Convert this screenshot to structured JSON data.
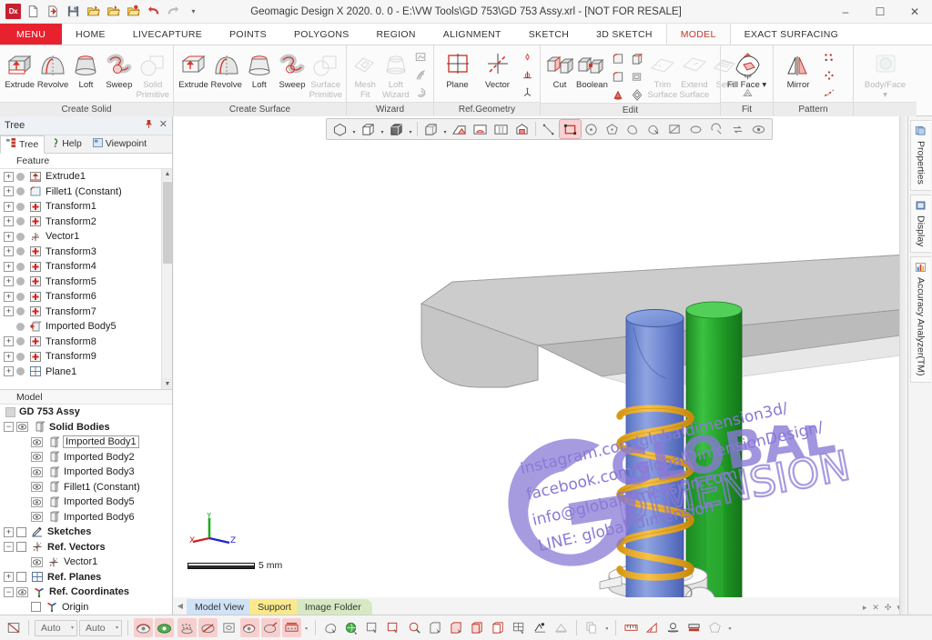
{
  "window": {
    "title": "Geomagic Design X 2020. 0. 0 - E:\\VW Tools\\GD 753\\GD 753 Assy.xrl - [NOT FOR RESALE]",
    "app_badge": "Dx",
    "minimize": "–",
    "maximize": "☐",
    "close": "✕"
  },
  "quick_access": [
    {
      "name": "app-logo-icon",
      "label": "Dx"
    },
    {
      "name": "new-document-icon",
      "label": ""
    },
    {
      "name": "import-icon",
      "label": ""
    },
    {
      "name": "save-icon",
      "label": ""
    },
    {
      "name": "open-folder-icon",
      "label": ""
    },
    {
      "name": "open-folder-2-icon",
      "label": ""
    },
    {
      "name": "open-folder-3-icon",
      "label": ""
    },
    {
      "name": "undo-icon",
      "label": ""
    },
    {
      "name": "redo-icon",
      "label": ""
    },
    {
      "name": "customize-caret-icon",
      "label": "▾"
    }
  ],
  "ribbon_tabs": [
    {
      "label": "MENU",
      "kind": "menu"
    },
    {
      "label": "HOME",
      "kind": "normal"
    },
    {
      "label": "LIVECAPTURE",
      "kind": "normal"
    },
    {
      "label": "POINTS",
      "kind": "normal"
    },
    {
      "label": "POLYGONS",
      "kind": "normal"
    },
    {
      "label": "REGION",
      "kind": "normal"
    },
    {
      "label": "ALIGNMENT",
      "kind": "normal"
    },
    {
      "label": "SKETCH",
      "kind": "normal"
    },
    {
      "label": "3D SKETCH",
      "kind": "normal"
    },
    {
      "label": "MODEL",
      "kind": "active"
    },
    {
      "label": "EXACT SURFACING",
      "kind": "normal"
    }
  ],
  "ribbon_groups": [
    {
      "label": "Create Solid",
      "items": [
        {
          "label": "Extrude",
          "icon": "extrude-solid-icon",
          "disabled": false
        },
        {
          "label": "Revolve",
          "icon": "revolve-solid-icon",
          "disabled": false
        },
        {
          "label": "Loft",
          "icon": "loft-solid-icon",
          "disabled": false
        },
        {
          "label": "Sweep",
          "icon": "sweep-solid-icon",
          "disabled": false
        },
        {
          "label": "Solid Primitive",
          "icon": "solid-primitive-icon",
          "disabled": true
        }
      ]
    },
    {
      "label": "Create Surface",
      "items": [
        {
          "label": "Extrude",
          "icon": "extrude-surface-icon",
          "disabled": false
        },
        {
          "label": "Revolve",
          "icon": "revolve-surface-icon",
          "disabled": false
        },
        {
          "label": "Loft",
          "icon": "loft-surface-icon",
          "disabled": false
        },
        {
          "label": "Sweep",
          "icon": "sweep-surface-icon",
          "disabled": false
        },
        {
          "label": "Surface Primitive",
          "icon": "surface-primitive-icon",
          "disabled": true
        }
      ]
    },
    {
      "label": "Wizard",
      "items": [
        {
          "label": "Mesh Fit",
          "icon": "mesh-fit-icon",
          "disabled": true
        },
        {
          "label": "Loft Wizard",
          "icon": "loft-wizard-icon",
          "disabled": true
        }
      ],
      "minis": [
        {
          "icon": "auto-surface-icon"
        },
        {
          "icon": "mesh-sketch-icon"
        },
        {
          "icon": "mesh-spiral-icon"
        }
      ]
    },
    {
      "label": "Ref.Geometry",
      "items": [
        {
          "label": "Plane",
          "icon": "plane-icon",
          "disabled": false
        },
        {
          "label": "Vector",
          "icon": "vector-icon",
          "disabled": false
        }
      ],
      "minis": [
        {
          "icon": "ref-point-icon"
        },
        {
          "icon": "ref-polyline-icon"
        },
        {
          "icon": "ref-coordinate-icon"
        }
      ]
    },
    {
      "label": "Edit",
      "items": [
        {
          "label": "Cut",
          "icon": "cut-icon",
          "disabled": false
        },
        {
          "label": "Boolean",
          "icon": "boolean-icon",
          "disabled": false
        },
        {
          "label": "Trim Surface",
          "icon": "trim-surface-icon",
          "disabled": true
        },
        {
          "label": "Extend Surface",
          "icon": "extend-surface-icon",
          "disabled": true
        },
        {
          "label": "Sew",
          "icon": "sew-icon",
          "disabled": true
        }
      ],
      "minis": [
        {
          "icon": "fillet-icon"
        },
        {
          "icon": "shell-icon"
        },
        {
          "icon": "draft-icon"
        },
        {
          "icon": "offset-icon"
        },
        {
          "icon": "move-face-icon"
        },
        {
          "icon": "delete-face-icon"
        },
        {
          "icon": "symmetry-icon"
        },
        {
          "icon": "thicken-icon"
        }
      ]
    },
    {
      "label": "Fit",
      "items": [
        {
          "label": "Fill Face ▾",
          "icon": "fill-face-icon",
          "disabled": false
        }
      ]
    },
    {
      "label": "Pattern",
      "items": [
        {
          "label": "Mirror",
          "icon": "mirror-icon",
          "disabled": false
        }
      ],
      "minis": [
        {
          "icon": "linear-pattern-icon"
        },
        {
          "icon": "circular-pattern-icon"
        },
        {
          "icon": "curve-pattern-icon"
        }
      ]
    },
    {
      "label": "",
      "items": [
        {
          "label": "Body/Face ▾",
          "icon": "body-face-icon",
          "disabled": true
        }
      ]
    }
  ],
  "left_panel": {
    "title": "Tree",
    "pin_icon": "pin-icon",
    "close_icon": "close-icon",
    "tabs": [
      {
        "label": "Tree",
        "icon": "tree-icon",
        "active": true
      },
      {
        "label": "Help",
        "icon": "help-icon",
        "active": false
      },
      {
        "label": "Viewpoint",
        "icon": "viewpoint-icon",
        "active": false
      }
    ],
    "feature_header": "Feature",
    "features": [
      {
        "label": "Extrude1",
        "icon": "extrude-feature-icon",
        "expandable": true
      },
      {
        "label": "Fillet1 (Constant)",
        "icon": "fillet-feature-icon",
        "expandable": true
      },
      {
        "label": "Transform1",
        "icon": "transform-feature-icon",
        "expandable": true
      },
      {
        "label": "Transform2",
        "icon": "transform-feature-icon",
        "expandable": true
      },
      {
        "label": "Vector1",
        "icon": "vector-feature-icon",
        "expandable": true
      },
      {
        "label": "Transform3",
        "icon": "transform-feature-icon",
        "expandable": true
      },
      {
        "label": "Transform4",
        "icon": "transform-feature-icon",
        "expandable": true
      },
      {
        "label": "Transform5",
        "icon": "transform-feature-icon",
        "expandable": true
      },
      {
        "label": "Transform6",
        "icon": "transform-feature-icon",
        "expandable": true
      },
      {
        "label": "Transform7",
        "icon": "transform-feature-icon",
        "expandable": true
      },
      {
        "label": "Imported Body5",
        "icon": "imported-body-feature-icon",
        "expandable": false
      },
      {
        "label": "Transform8",
        "icon": "transform-feature-icon",
        "expandable": true
      },
      {
        "label": "Transform9",
        "icon": "transform-feature-icon",
        "expandable": true
      },
      {
        "label": "Plane1",
        "icon": "plane-feature-icon",
        "expandable": true
      }
    ],
    "model_header": "Model",
    "model_root": "GD 753 Assy",
    "model_tree": [
      {
        "label": "Solid Bodies",
        "icon": "folder-body-icon",
        "indent": 1,
        "bold": true,
        "expander": "minus",
        "eye": true
      },
      {
        "label": "Imported Body1",
        "icon": "body-icon",
        "indent": 2,
        "bold": false,
        "expander": "none",
        "eye": true,
        "selected": true
      },
      {
        "label": "Imported Body2",
        "icon": "body-icon",
        "indent": 2,
        "bold": false,
        "expander": "none",
        "eye": true
      },
      {
        "label": "Imported Body3",
        "icon": "body-icon",
        "indent": 2,
        "bold": false,
        "expander": "none",
        "eye": true
      },
      {
        "label": "Fillet1 (Constant)",
        "icon": "body-icon",
        "indent": 2,
        "bold": false,
        "expander": "none",
        "eye": true
      },
      {
        "label": "Imported Body5",
        "icon": "body-icon",
        "indent": 2,
        "bold": false,
        "expander": "none",
        "eye": true
      },
      {
        "label": "Imported Body6",
        "icon": "body-icon",
        "indent": 2,
        "bold": false,
        "expander": "none",
        "eye": true
      },
      {
        "label": "Sketches",
        "icon": "sketches-icon",
        "indent": 1,
        "bold": true,
        "expander": "plus",
        "check": true
      },
      {
        "label": "Ref. Vectors",
        "icon": "ref-vectors-icon",
        "indent": 1,
        "bold": true,
        "expander": "minus",
        "check": true
      },
      {
        "label": "Vector1",
        "icon": "ref-vectors-icon",
        "indent": 2,
        "bold": false,
        "expander": "none",
        "eye": true
      },
      {
        "label": "Ref. Planes",
        "icon": "ref-planes-icon",
        "indent": 1,
        "bold": true,
        "expander": "plus",
        "check": true
      },
      {
        "label": "Ref. Coordinates",
        "icon": "ref-coords-icon",
        "indent": 1,
        "bold": true,
        "expander": "minus",
        "eye": true
      },
      {
        "label": "Origin",
        "icon": "ref-coords-icon",
        "indent": 2,
        "bold": false,
        "expander": "none",
        "check": true
      }
    ]
  },
  "viewport": {
    "toolbar_left": [
      {
        "icon": "shade-mode-icon",
        "caret": true,
        "state": "off"
      },
      {
        "icon": "wireframe-mode-icon",
        "caret": true,
        "state": "off"
      },
      {
        "icon": "shade-wireframe-icon",
        "caret": true,
        "state": "off"
      },
      {
        "icon": "transparent-mode-icon",
        "caret": true,
        "state": "off"
      },
      {
        "icon": "section-front-icon",
        "caret": false,
        "state": "off"
      },
      {
        "icon": "section-half-icon",
        "caret": false,
        "state": "off"
      },
      {
        "icon": "section-double-icon",
        "caret": false,
        "state": "off"
      },
      {
        "icon": "deviation-icon",
        "caret": false,
        "state": "off"
      }
    ],
    "toolbar_right": [
      {
        "icon": "measure-distance-icon",
        "state": "off"
      },
      {
        "icon": "rectangle-select-icon",
        "state": "on"
      },
      {
        "icon": "circle-select-icon",
        "state": "off"
      },
      {
        "icon": "polygon-select-icon",
        "state": "off"
      },
      {
        "icon": "freehand-select-icon",
        "state": "off"
      },
      {
        "icon": "paint-select-icon",
        "state": "off"
      },
      {
        "icon": "plane-select-icon",
        "state": "off"
      },
      {
        "icon": "expand-select-icon",
        "state": "off"
      },
      {
        "icon": "shrink-select-icon",
        "state": "off"
      },
      {
        "icon": "flip-select-icon",
        "state": "off"
      },
      {
        "icon": "visible-only-icon",
        "state": "off"
      }
    ],
    "axes": {
      "x": "X",
      "y": "Y",
      "z": "Z"
    },
    "scale_label": "5 mm",
    "tabs": [
      {
        "label": "Model View",
        "color": "blue"
      },
      {
        "label": "Support",
        "color": "yellow"
      },
      {
        "label": "Image Folder",
        "color": "green"
      }
    ],
    "tab_controls": [
      "▸",
      "✕",
      "✣",
      "▾"
    ]
  },
  "watermark": {
    "brand_top": "GLOBAL",
    "brand_bottom": "DIMENSION",
    "lines": [
      "instagram.com/globaldimension3d/",
      "facebook.com/GlobalDimensionDesign/",
      "info@globaldimension.com",
      "LINE: global_dimension"
    ],
    "color": "#8a79d6"
  },
  "right_dock": [
    {
      "label": "Properties",
      "icon": "properties-icon"
    },
    {
      "label": "Display",
      "icon": "display-icon"
    },
    {
      "label": "Accuracy Analyzer(TM)",
      "icon": "accuracy-analyzer-icon"
    }
  ],
  "statusbar": {
    "selection_icon": "selection-mode-icon",
    "combo1": {
      "value": "Auto",
      "caret": "▾"
    },
    "combo2": {
      "value": "Auto",
      "caret": "▾"
    },
    "group1": [
      {
        "icon": "show-mesh-icon",
        "state": "on"
      },
      {
        "icon": "show-color-mesh-icon",
        "state": "on"
      },
      {
        "icon": "show-point-cloud-icon",
        "state": "on"
      },
      {
        "icon": "show-hidden-icon",
        "state": "on"
      },
      {
        "icon": "show-region-icon",
        "state": "off"
      },
      {
        "icon": "show-sketch-icon",
        "state": "on"
      },
      {
        "icon": "show-body-icon",
        "state": "on"
      },
      {
        "icon": "show-ref-icon",
        "state": "off"
      },
      {
        "icon": "show-plane-icon",
        "state": "off"
      },
      {
        "icon": "show-scan-icon",
        "state": "on"
      },
      {
        "icon": "show-mesh-edges-icon",
        "state": "on"
      },
      {
        "icon": "show-texture-icon",
        "state": "on"
      }
    ],
    "group2": [
      {
        "icon": "pick-entity-icon"
      },
      {
        "icon": "pick-world-icon"
      },
      {
        "icon": "pick-face-icon"
      },
      {
        "icon": "pick-surface-icon"
      },
      {
        "icon": "pick-zoom-icon"
      },
      {
        "icon": "pick-body-icon"
      },
      {
        "icon": "pick-box-icon"
      },
      {
        "icon": "pick-solid-icon"
      },
      {
        "icon": "pick-shell-icon"
      },
      {
        "icon": "pick-cell-icon"
      },
      {
        "icon": "pick-grid-icon"
      }
    ],
    "group3": [
      {
        "icon": "measure-tool-icon"
      },
      {
        "icon": "section-tool-icon"
      }
    ],
    "group4": [
      {
        "icon": "copy-tool-icon"
      }
    ],
    "group5": [
      {
        "icon": "ruler-icon"
      },
      {
        "icon": "angle-icon"
      },
      {
        "icon": "stand-icon"
      },
      {
        "icon": "stack-icon"
      },
      {
        "icon": "polygon-tool-icon"
      }
    ]
  }
}
